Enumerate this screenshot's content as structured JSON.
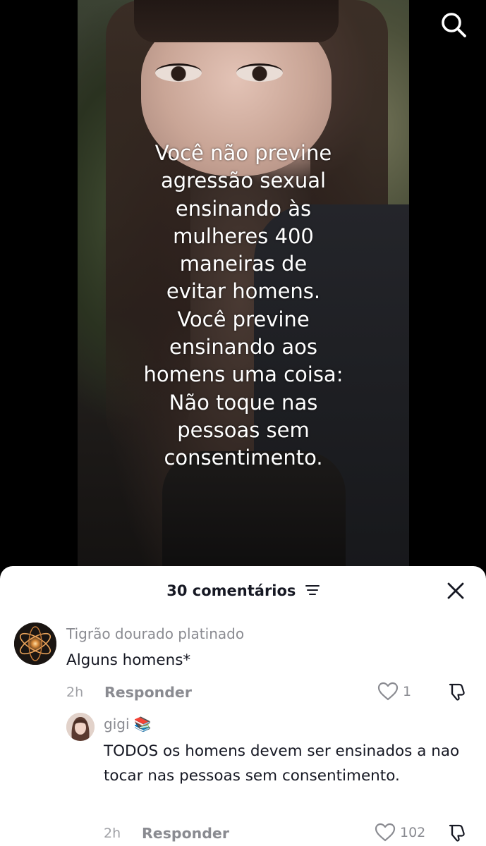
{
  "video": {
    "overlay_lines": [
      "Você não previne",
      "agressão sexual",
      "ensinando às",
      "mulheres 400",
      "maneiras de",
      "evitar homens.",
      "Você previne",
      "ensinando aos",
      "homens uma coisa:",
      "Não toque nas",
      "pessoas sem",
      "consentimento."
    ],
    "search_icon": "search-icon"
  },
  "comments_panel": {
    "count_label": "30 comentários",
    "sort_icon": "sort-icon",
    "close_icon": "close-icon",
    "comments": [
      {
        "author": "Tigrão dourado platinado",
        "text": "Alguns homens*",
        "time": "2h",
        "reply_label": "Responder",
        "likes": "1"
      },
      {
        "author": "gigi 📚",
        "text": "TODOS os homens devem ser ensinados a nao tocar nas pessoas sem consentimento.",
        "time": "2h",
        "reply_label": "Responder",
        "likes": "102"
      }
    ]
  },
  "colors": {
    "text_primary": "#161823",
    "text_secondary": "#8a8b91",
    "sheet_bg": "#ffffff",
    "video_bg": "#000000"
  }
}
